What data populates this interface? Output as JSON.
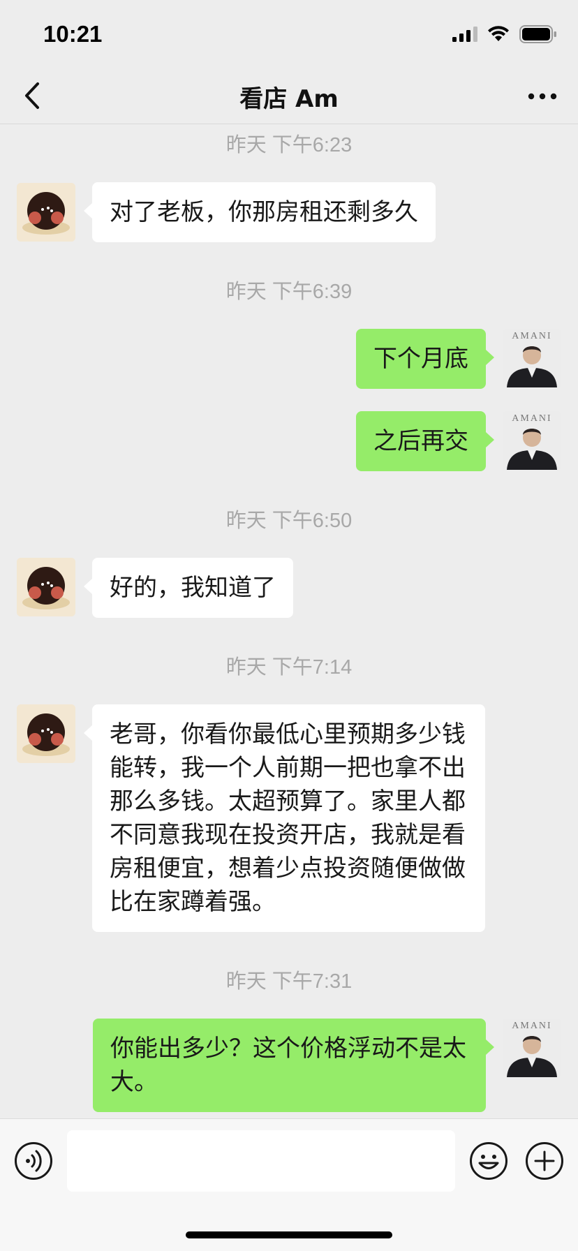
{
  "status_bar": {
    "time": "10:21"
  },
  "nav": {
    "title": "看店 Am"
  },
  "messages": {
    "t1": "昨天 下午6:23",
    "m1": "对了老板，你那房租还剩多久",
    "t2": "昨天 下午6:39",
    "m2": "下个月底",
    "m3": "之后再交",
    "t3": "昨天 下午6:50",
    "m4": "好的，我知道了",
    "t4": "昨天 下午7:14",
    "m5": "老哥，你看你最低心里预期多少钱能转，我一个人前期一把也拿不出那么多钱。太超预算了。家里人都不同意我现在投资开店，我就是看房租便宜，想着少点投资随便做做比在家蹲着强。",
    "t5": "昨天 下午7:31",
    "m6": "你能出多少？这个价格浮动不是太大。"
  },
  "avatar_right": {
    "logo_text": "AMANI"
  },
  "input": {
    "value": "",
    "placeholder": ""
  },
  "colors": {
    "background": "#ededed",
    "sent_bubble": "#95ec69",
    "received_bubble": "#ffffff",
    "timestamp": "#a8a8a8"
  },
  "icons": {
    "back": "chevron-left-icon",
    "more": "more-dots-icon",
    "voice": "voice-icon",
    "emoji": "emoji-icon",
    "plus": "plus-icon"
  }
}
